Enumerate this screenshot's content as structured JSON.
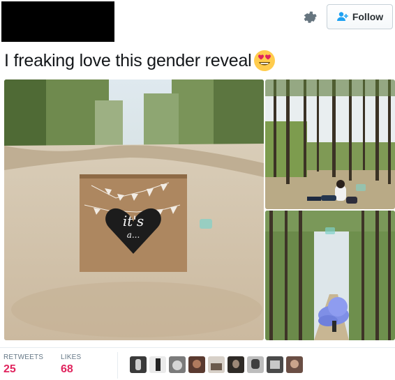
{
  "header": {
    "follow_label": "Follow",
    "gear_icon": "gear-icon",
    "follow_icon": "add-user-icon"
  },
  "tweet": {
    "text": "I freaking love this gender reveal",
    "emoji": "heart-eyes-emoji"
  },
  "photo": {
    "box_text_line1": "it's",
    "box_text_line2": "a..."
  },
  "stats": {
    "retweets_label": "RETWEETS",
    "retweets_value": "25",
    "likes_label": "LIKES",
    "likes_value": "68"
  },
  "colors": {
    "likes_accent": "#e0245e",
    "follow_icon": "#1da1f2"
  },
  "avatars": [
    "avatar-1",
    "avatar-2",
    "avatar-3",
    "avatar-4",
    "avatar-5",
    "avatar-6",
    "avatar-7",
    "avatar-8",
    "avatar-9"
  ]
}
